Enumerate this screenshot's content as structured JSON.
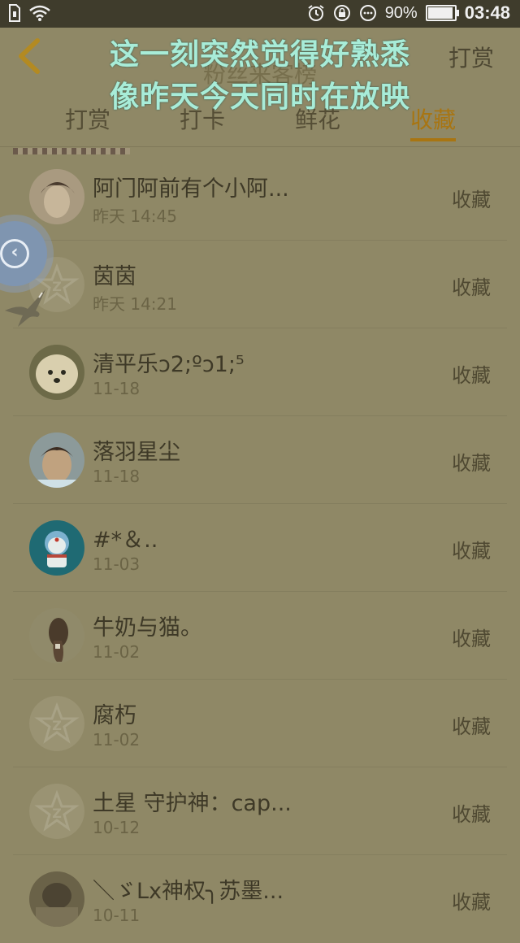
{
  "status_bar": {
    "battery": "90%",
    "time": "03:48",
    "battery_level": 0.9
  },
  "header": {
    "title": "粉丝来客榜",
    "right_action": "打赏"
  },
  "overlay": {
    "line1": "这一刻突然觉得好熟悉",
    "line2": "像昨天今天同时在放映"
  },
  "tabs": [
    {
      "label": "打赏",
      "active": false
    },
    {
      "label": "打卡",
      "active": false
    },
    {
      "label": "鲜花",
      "active": false
    },
    {
      "label": "收藏",
      "active": true
    }
  ],
  "list": [
    {
      "name": "阿门阿前有个小阿...",
      "time": "昨天 14:45",
      "action": "收藏",
      "avatar": "photo-boy"
    },
    {
      "name": "茵茵",
      "time": "昨天 14:21",
      "action": "收藏",
      "avatar": "default-star"
    },
    {
      "name": "清平乐ↄ2;ºↄ1;⁵",
      "time": "11-18",
      "action": "收藏",
      "avatar": "photo-dog"
    },
    {
      "name": "落羽星尘",
      "time": "11-18",
      "action": "收藏",
      "avatar": "photo-man"
    },
    {
      "name": "#*＆..",
      "time": "11-03",
      "action": "收藏",
      "avatar": "doraemon"
    },
    {
      "name": "牛奶与猫。",
      "time": "11-02",
      "action": "收藏",
      "avatar": "photo-girl"
    },
    {
      "name": "腐朽",
      "time": "11-02",
      "action": "收藏",
      "avatar": "default-star"
    },
    {
      "name": "土星 守护神：cap...",
      "time": "10-12",
      "action": "收藏",
      "avatar": "default-star"
    },
    {
      "name": "＼ゞLx神权╮苏墨...",
      "time": "10-11",
      "action": "收藏",
      "avatar": "photo-dark"
    }
  ],
  "colors": {
    "background": "#8f8866",
    "accent": "#a87512",
    "overlay_text": "#a8ecd8",
    "status_bar": "#3f3c2c"
  }
}
